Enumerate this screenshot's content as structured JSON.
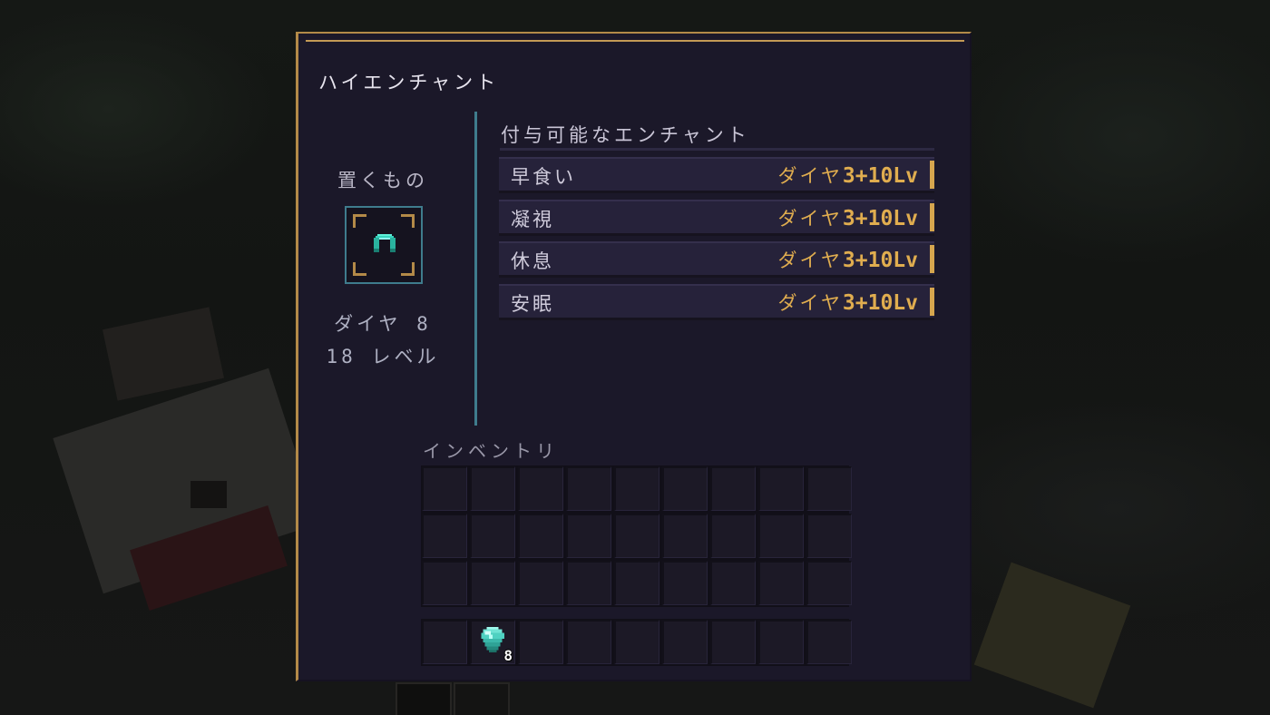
{
  "colors": {
    "panel_bg": "#1b1829",
    "gold_border": "#b38a48",
    "teal_accent": "#3f7c8d",
    "cost_gold": "#e0ad4f",
    "text_light": "#cfcbdb"
  },
  "window": {
    "title": "ハイエンチャント"
  },
  "input_slot": {
    "label": "置くもの",
    "item_icon": "diamond-helmet-icon"
  },
  "cost": {
    "diamond_text": "ダイヤ 8",
    "level_text": "18 レベル"
  },
  "enchantments": {
    "title": "付与可能なエンチャント",
    "items": [
      {
        "name": "早食い",
        "cost_prefix": "ダイヤ",
        "cost_value": "3+10Lv"
      },
      {
        "name": "凝視",
        "cost_prefix": "ダイヤ",
        "cost_value": "3+10Lv"
      },
      {
        "name": "休息",
        "cost_prefix": "ダイヤ",
        "cost_value": "3+10Lv"
      },
      {
        "name": "安眠",
        "cost_prefix": "ダイヤ",
        "cost_value": "3+10Lv"
      }
    ]
  },
  "inventory": {
    "label": "インベントリ",
    "main_rows": 3,
    "columns": 9,
    "hotbar": [
      {
        "slot": 1,
        "item": "diamond-icon",
        "count": "8"
      }
    ]
  }
}
